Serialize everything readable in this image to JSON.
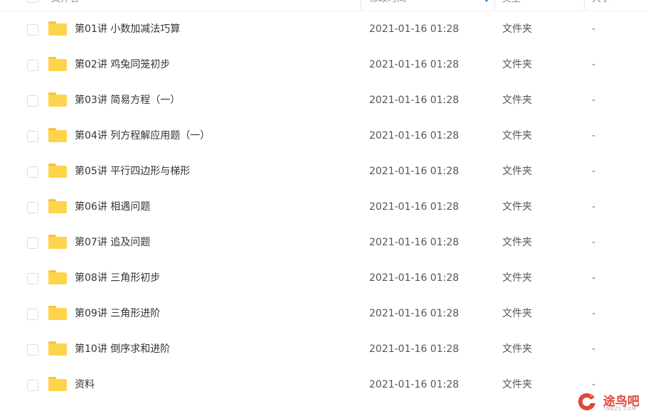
{
  "header": {
    "col_name": "文件名",
    "col_time": "修改时间",
    "col_type": "类型",
    "col_size": "大小"
  },
  "rows": [
    {
      "name": "第01讲 小数加减法巧算",
      "time": "2021-01-16 01:28",
      "type": "文件夹",
      "size": "-"
    },
    {
      "name": "第02讲 鸡兔同笼初步",
      "time": "2021-01-16 01:28",
      "type": "文件夹",
      "size": "-"
    },
    {
      "name": "第03讲 简易方程（一）",
      "time": "2021-01-16 01:28",
      "type": "文件夹",
      "size": "-"
    },
    {
      "name": "第04讲 列方程解应用题（一）",
      "time": "2021-01-16 01:28",
      "type": "文件夹",
      "size": "-"
    },
    {
      "name": "第05讲 平行四边形与梯形",
      "time": "2021-01-16 01:28",
      "type": "文件夹",
      "size": "-"
    },
    {
      "name": "第06讲 相遇问题",
      "time": "2021-01-16 01:28",
      "type": "文件夹",
      "size": "-"
    },
    {
      "name": "第07讲 追及问题",
      "time": "2021-01-16 01:28",
      "type": "文件夹",
      "size": "-"
    },
    {
      "name": "第08讲 三角形初步",
      "time": "2021-01-16 01:28",
      "type": "文件夹",
      "size": "-"
    },
    {
      "name": "第09讲 三角形进阶",
      "time": "2021-01-16 01:28",
      "type": "文件夹",
      "size": "-"
    },
    {
      "name": "第10讲 倒序求和进阶",
      "time": "2021-01-16 01:28",
      "type": "文件夹",
      "size": "-"
    },
    {
      "name": "资料",
      "time": "2021-01-16 01:28",
      "type": "文件夹",
      "size": "-"
    }
  ],
  "watermark": {
    "text": "途鸟吧",
    "sub": "TNBZS.COM"
  },
  "colors": {
    "folder": "#ffd44d",
    "accent": "#2b8cf7",
    "watermark": "#e0483c"
  },
  "icons": {
    "folder": "folder-icon",
    "sort": "sort-down-icon",
    "checkbox": "checkbox"
  }
}
